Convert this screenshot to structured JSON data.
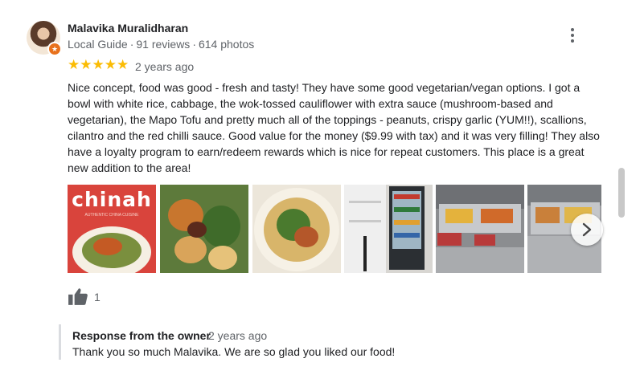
{
  "reviewer": {
    "name": "Malavika Muralidharan",
    "level": "Local Guide",
    "reviews": "91 reviews",
    "photos": "614 photos",
    "separator": "·"
  },
  "rating": {
    "stars": "★★★★★",
    "value_out_of_5": 5,
    "date": "2 years ago"
  },
  "review_text": "Nice concept, food was good - fresh and tasty! They have some good vegetarian/vegan options. I got a bowl with white rice, cabbage, the wok-tossed cauliflower with extra sauce (mushroom-based and vegetarian), the Mapo Tofu and pretty much all of the toppings - peanuts, crispy garlic (YUM!!), scallions, cilantro and the red chilli sauce. Good value for the money ($9.99 with tax) and it was very filling! They also have a loyalty program to earn/redeem rewards which is nice for repeat customers. This place is a great new addition to the area!",
  "photos": {
    "logo_text": "chinah",
    "logo_subtext": "AUTHENTIC CHINA CUISINE"
  },
  "likes": {
    "count": "1"
  },
  "owner_response": {
    "title": "Response from the owner",
    "date": "2 years ago",
    "text": "Thank you so much Malavika. We are so glad you liked our food!"
  },
  "icons": {
    "more": "more-vert-icon",
    "like": "thumb-up-icon",
    "next": "chevron-right-icon",
    "badge": "local-guide-star-icon"
  },
  "colors": {
    "star": "#fbbc04",
    "badge": "#e8711c",
    "muted_text": "#5f6368"
  }
}
